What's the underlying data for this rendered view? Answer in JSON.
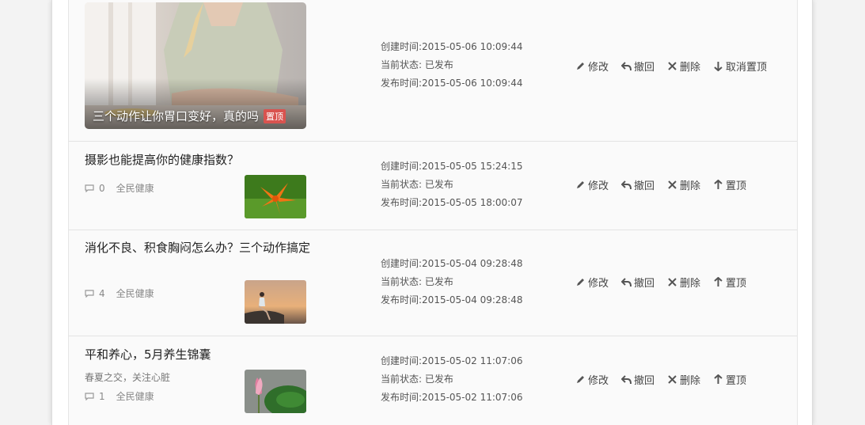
{
  "hero": {
    "title": "三个动作让你胃口变好，真的吗",
    "badge": "置顶",
    "created": "创建时间:2015-05-06 10:09:44",
    "status": "当前状态: 已发布",
    "published": "发布时间:2015-05-06 10:09:44",
    "actions": {
      "edit": "修改",
      "withdraw": "撤回",
      "delete": "删除",
      "pin": "取消置顶"
    }
  },
  "articles": [
    {
      "title": "摄影也能提高你的健康指数？",
      "comments": "0",
      "category": "全民健康",
      "created": "创建时间:2015-05-05 15:24:15",
      "status": "当前状态: 已发布",
      "published": "发布时间:2015-05-05 18:00:07",
      "actions": {
        "edit": "修改",
        "withdraw": "撤回",
        "delete": "删除",
        "pin": "置顶"
      }
    },
    {
      "title": "消化不良、积食胸闷怎么办？三个动作搞定",
      "comments": "4",
      "category": "全民健康",
      "created": "创建时间:2015-05-04 09:28:48",
      "status": "当前状态: 已发布",
      "published": "发布时间:2015-05-04 09:28:48",
      "actions": {
        "edit": "修改",
        "withdraw": "撤回",
        "delete": "删除",
        "pin": "置顶"
      }
    },
    {
      "title": "平和养心，5月养生锦囊",
      "summary": "春夏之交，关注心脏",
      "comments": "1",
      "category": "全民健康",
      "created": "创建时间:2015-05-02 11:07:06",
      "status": "当前状态: 已发布",
      "published": "发布时间:2015-05-02 11:07:06",
      "actions": {
        "edit": "修改",
        "withdraw": "撤回",
        "delete": "删除",
        "pin": "置顶"
      }
    }
  ]
}
